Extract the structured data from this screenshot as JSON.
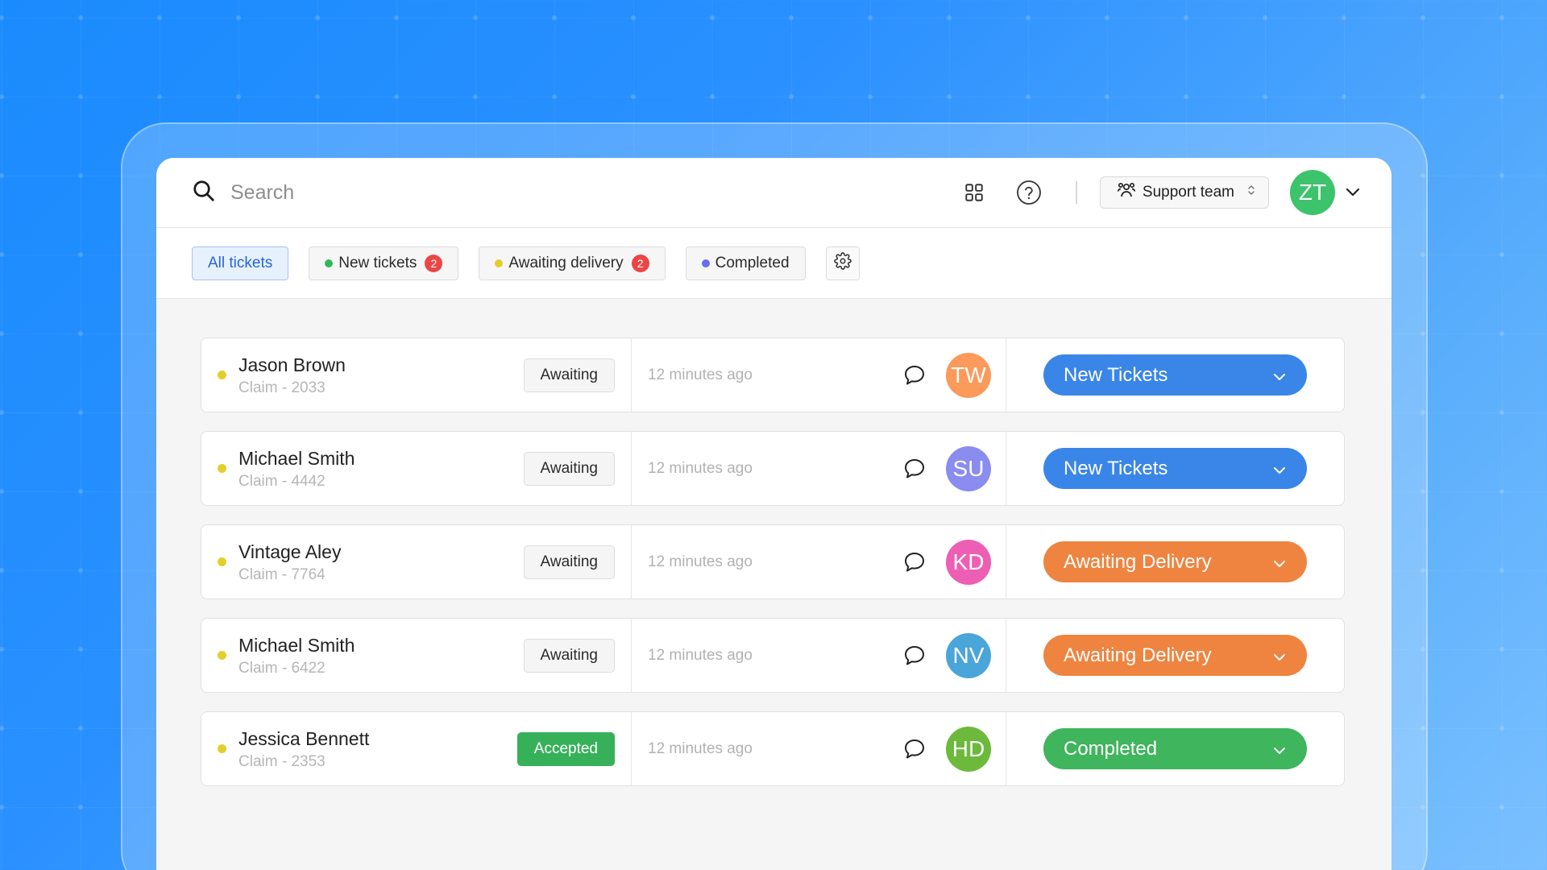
{
  "search": {
    "placeholder": "Search"
  },
  "header": {
    "team_label": "Support team",
    "user_initials": "ZT",
    "user_color": "#3cc36b"
  },
  "filters": [
    {
      "label": "All tickets",
      "active": true
    },
    {
      "label": "New tickets",
      "dot_color": "#2fb95b",
      "count": "2"
    },
    {
      "label": "Awaiting delivery",
      "dot_color": "#e3cf2c",
      "count": "2"
    },
    {
      "label": "Completed",
      "dot_color": "#6c6cf0"
    }
  ],
  "tickets": [
    {
      "name": "Jason Brown",
      "claim": "Claim  - 2033",
      "status": "Awaiting",
      "time": "12 minutes ago",
      "initials": "TW",
      "avatar_color": "#fb9a5a",
      "state": "New Tickets",
      "state_color": "#3a86e8"
    },
    {
      "name": "Michael Smith",
      "claim": "Claim  - 4442",
      "status": "Awaiting",
      "time": "12 minutes ago",
      "initials": "SU",
      "avatar_color": "#8a8cf0",
      "state": "New Tickets",
      "state_color": "#3a86e8"
    },
    {
      "name": "Vintage Aley",
      "claim": "Claim  - 7764",
      "status": "Awaiting",
      "time": "12 minutes ago",
      "initials": "KD",
      "avatar_color": "#ec5fb4",
      "state": "Awaiting Delivery",
      "state_color": "#ee8440"
    },
    {
      "name": "Michael Smith",
      "claim": "Claim  - 6422",
      "status": "Awaiting",
      "time": "12 minutes ago",
      "initials": "NV",
      "avatar_color": "#4aa5d9",
      "state": "Awaiting Delivery",
      "state_color": "#ee8440"
    },
    {
      "name": "Jessica Bennett",
      "claim": "Claim  - 2353",
      "status": "Accepted",
      "time": "12 minutes ago",
      "initials": "HD",
      "avatar_color": "#6cb93c",
      "state": "Completed",
      "state_color": "#3fb55d"
    }
  ]
}
